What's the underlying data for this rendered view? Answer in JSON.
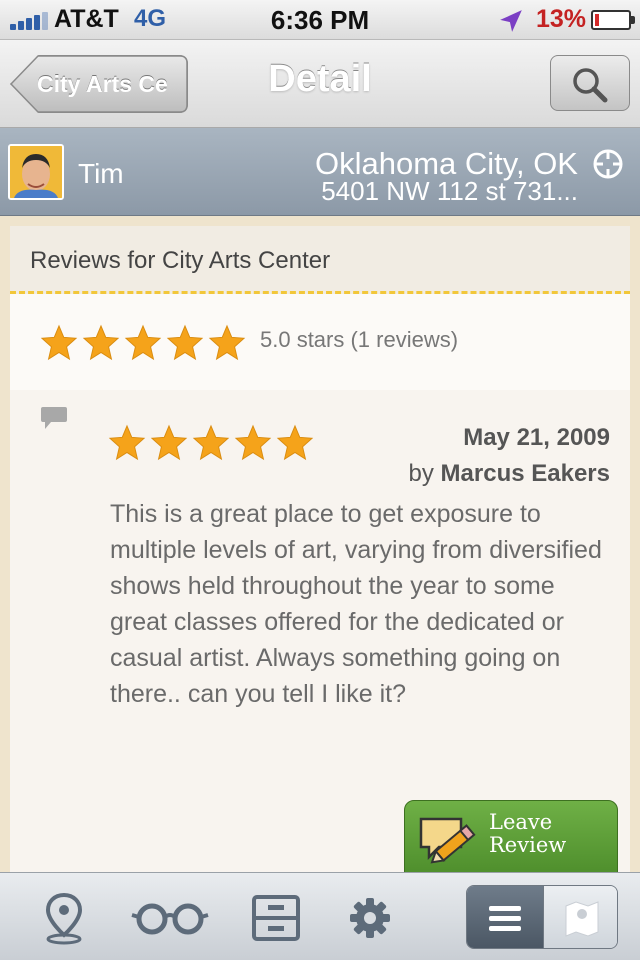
{
  "status_bar": {
    "carrier": "AT&T",
    "network": "4G",
    "time": "6:36 PM",
    "battery_percent": "13%",
    "battery_level": 0.13,
    "icons": [
      "signal-bars-icon",
      "location-arrow-icon",
      "battery-icon"
    ]
  },
  "nav": {
    "back_label": "City Arts Ce",
    "title": "Detail",
    "search_icon": "magnifier-icon"
  },
  "user": {
    "name": "Tim",
    "city": "Oklahoma City, OK",
    "address": "5401 NW 112 st 731...",
    "locate_icon": "crosshair-icon"
  },
  "reviews": {
    "header": "Reviews for City Arts Center",
    "overall_rating": 5,
    "summary": "5.0 stars  (1 reviews)",
    "items": [
      {
        "rating": 5,
        "date": "May 21, 2009",
        "by_prefix": "by",
        "author": "Marcus Eakers",
        "text": "This is a great place to get exposure to multiple levels of art, varying from diversified shows held throughout the year to some great classes offered for the dedicated or casual artist. Always something going on there.. can you tell I like it?"
      }
    ]
  },
  "leave_review": {
    "line1": "Leave",
    "line2": "Review"
  },
  "tabbar": {
    "tabs": [
      "location-pin-icon",
      "glasses-icon",
      "file-cabinet-icon",
      "gear-icon"
    ],
    "segments": [
      "list-icon",
      "map-icon"
    ],
    "selected_segment": "list"
  },
  "colors": {
    "star": "#f5a31a",
    "accent_green": "#5a9c35",
    "user_bar": "#97a3b0",
    "battery_low": "#d42a2a"
  }
}
